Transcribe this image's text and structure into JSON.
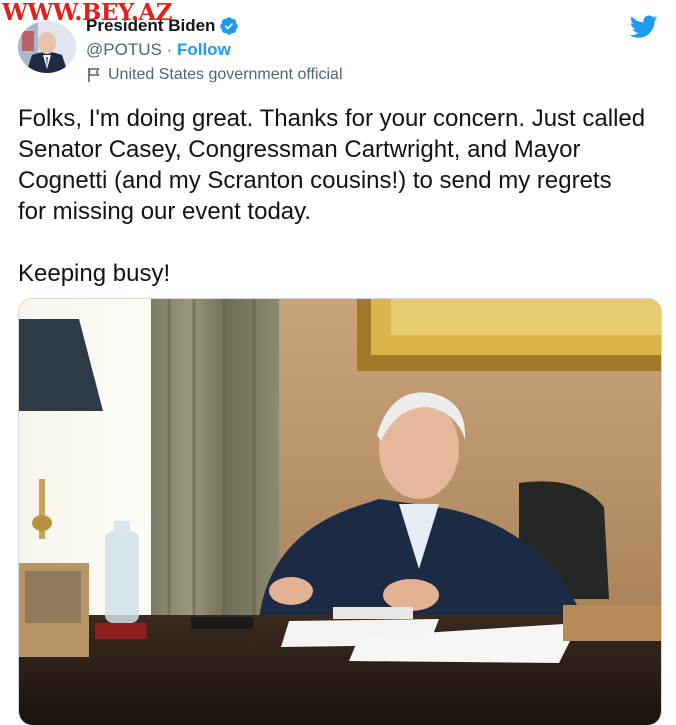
{
  "watermark": "WWW.BEY.AZ",
  "author": {
    "name": "President Biden",
    "handle": "@POTUS",
    "separator": "·",
    "follow_label": "Follow",
    "label": "United States government official"
  },
  "tweet": {
    "text": "Folks, I'm doing great. Thanks for your concern. Just called\nSenator Casey, Congressman Cartwright, and Mayor\nCognetti (and my Scranton cousins!) to send my regrets\nfor missing our event today.\n\nKeeping busy!"
  },
  "icons": {
    "verified": "verified-badge-icon",
    "flag": "flag-icon",
    "logo": "twitter-bird-icon"
  },
  "colors": {
    "accent": "#1d9bf0",
    "secondary_text": "#536471",
    "watermark": "#e0201b"
  }
}
